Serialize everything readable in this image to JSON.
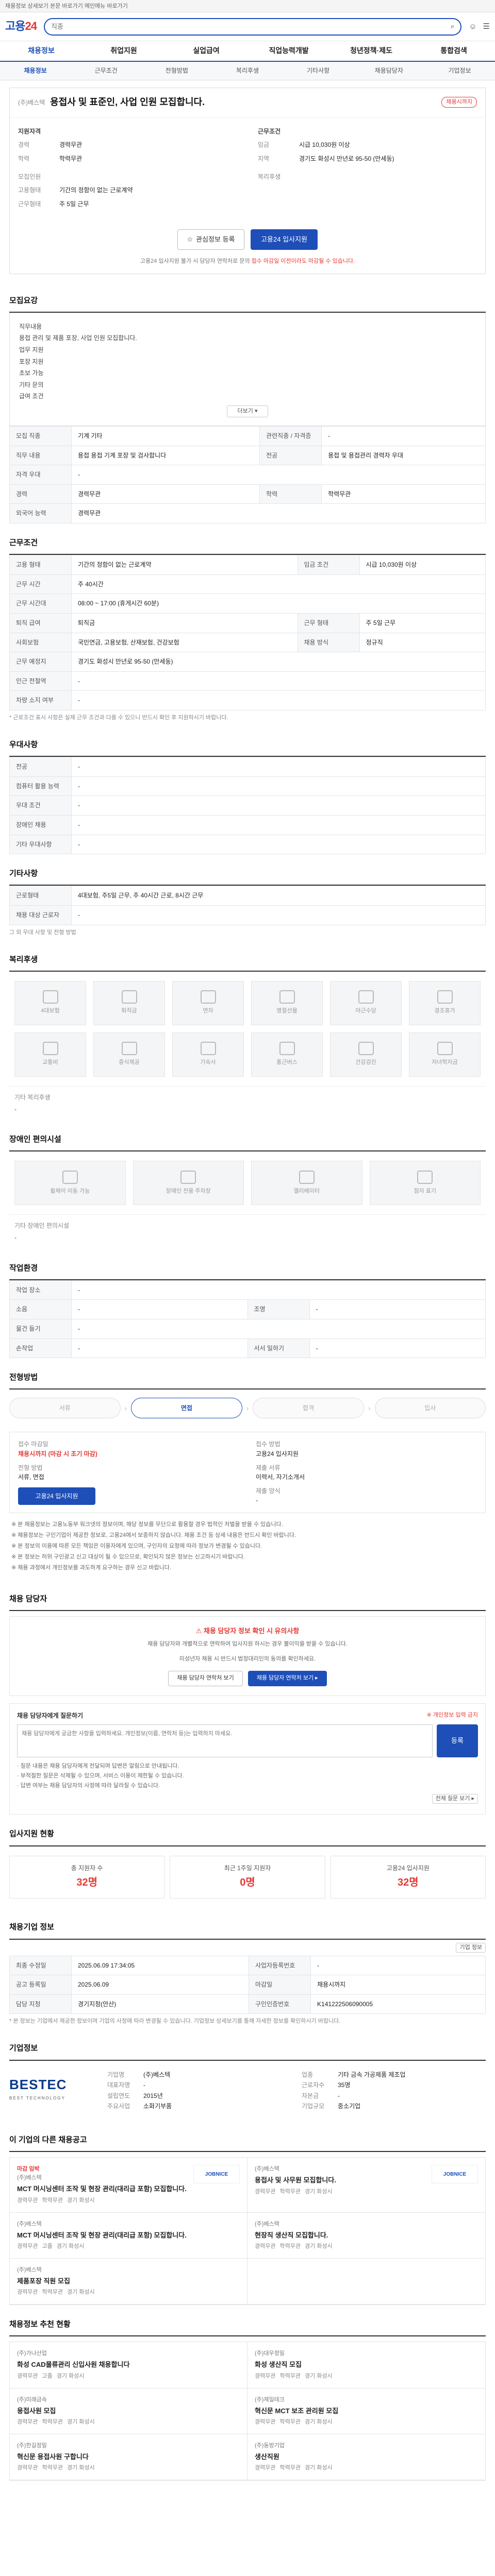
{
  "topbar": {
    "text": "채용정보 상세보기 본문 바로가기 메인메뉴 바로가기"
  },
  "header": {
    "logo_main": "고용",
    "logo_accent": "24",
    "search_placeholder": "직종"
  },
  "nav": [
    "채용정보",
    "취업지원",
    "실업급여",
    "직업능력개발",
    "청년정책·제도",
    "통합검색"
  ],
  "subnav": [
    "채용정보",
    "근무조건",
    "전형방법",
    "복리후생",
    "기타사항",
    "채용담당자",
    "기업정보"
  ],
  "job": {
    "company": "(주)베스텍",
    "title": "용접사 및 표준인, 사업 인원 모집합니다.",
    "badge": "채용시까지",
    "left_head": "지원자격",
    "right_head": "근무조건",
    "left_rows": [
      {
        "k": "경력",
        "v": "경력무관"
      },
      {
        "k": "학력",
        "v": "학력무관"
      },
      {
        "k": "",
        "v": ""
      },
      {
        "k": "모집인원",
        "v": ""
      },
      {
        "k": "고용형태",
        "v": "기간의 정함이 없는 근로계약"
      },
      {
        "k": "근무형태",
        "v": "주 5일 근무"
      }
    ],
    "right_rows": [
      {
        "k": "임금",
        "v": "시급 10,030원 이상"
      },
      {
        "k": "지역",
        "v": "경기도 화성시 만년로 95-50 (만세동)"
      },
      {
        "k": "",
        "v": ""
      },
      {
        "k": "복리후생",
        "v": ""
      }
    ],
    "btn_scrap": "관심정보 등록",
    "btn_apply": "고용24 입사지원",
    "notice_pre": "고용24 입사지원 불가 시 담당자 연락처로 문의",
    "notice_red": "접수 마감일 이전이라도 마감될 수 있습니다."
  },
  "description": {
    "title": "모집요강",
    "lines": [
      "직무내용",
      "용접 관리 및 제품 포장, 사업 인원 모집합니다.",
      "업무 지원",
      "포장 지원",
      "초보 가능",
      "기타 문의",
      "급여 조건"
    ],
    "more": "더보기 ▾"
  },
  "requirements": {
    "rows": [
      {
        "k": "모집 직종",
        "v": "기계 기타",
        "k2": "관련직종 / 자격증",
        "v2": "-"
      },
      {
        "k": "직무 내용",
        "v": "용접 용접 기계 포장 및 검사합니다",
        "k2": "전공",
        "v2": "용접 및 용접관리 경력자 우대"
      },
      {
        "k": "자격 우대",
        "v": "-",
        "k2": "",
        "v2": ""
      },
      {
        "k": "경력",
        "v": "경력무관",
        "k2": "학력",
        "v2": "학력무관"
      },
      {
        "k": "외국어 능력",
        "v": "경력무관",
        "k2": "",
        "v2": ""
      }
    ]
  },
  "conditions": {
    "title": "근무조건",
    "rows": [
      {
        "k": "고용 형태",
        "v": "기간의 정함이 없는 근로계약",
        "k2": "임금 조건",
        "v2": "시급 10,030원 이상"
      },
      {
        "k": "근무 시간",
        "v": "주 40시간",
        "k2": "",
        "v2": ""
      },
      {
        "k": "근무 시간대",
        "v": "08:00 ~ 17:00 (휴게시간 60분)",
        "k2": "",
        "v2": ""
      },
      {
        "k": "퇴직 급여",
        "v": "퇴직금",
        "k2": "근무 형태",
        "v2": "주 5일 근무"
      },
      {
        "k": "사회보험",
        "v": "국민연금, 고용보험, 산재보험, 건강보험",
        "k2": "채용 방식",
        "v2": "정규직"
      },
      {
        "k": "근무 예정지",
        "v": "경기도 화성시 만년로 95-50 (만세동)",
        "k2": "",
        "v2": ""
      },
      {
        "k": "인근 전철역",
        "v": "-",
        "k2": "",
        "v2": ""
      },
      {
        "k": "차량 소지 여부",
        "v": "-",
        "k2": "",
        "v2": ""
      }
    ],
    "note": "* 근로조건 표시 사항은 실제 근무 조건과 다를 수 있으니 반드시 확인 후 지원하시기 바랍니다."
  },
  "prefs": {
    "title": "우대사항",
    "rows": [
      {
        "k": "전공",
        "v": "-"
      },
      {
        "k": "컴퓨터 활용 능력",
        "v": "-"
      },
      {
        "k": "우대 조건",
        "v": "-"
      },
      {
        "k": "장애인 채용",
        "v": "-"
      },
      {
        "k": "기타 우대사항",
        "v": "-"
      }
    ]
  },
  "etc": {
    "title": "기타사항",
    "rows": [
      {
        "k": "근로형태",
        "v": "4대보험, 주5일 근무, 주 40시간 근로, 8시간 근무"
      },
      {
        "k": "채용 대상 근로자",
        "v": "-"
      }
    ],
    "extra": "그 외 우대 사항 및 전형 방법"
  },
  "welfare": {
    "title": "복리후생",
    "items": [
      "4대보험",
      "퇴직금",
      "연차",
      "명절선물",
      "야근수당",
      "경조휴가",
      "교통비",
      "중식제공",
      "기숙사",
      "통근버스",
      "건강검진",
      "자녀학자금"
    ],
    "extra_k": "기타 복리후생",
    "extra_v": "-"
  },
  "disability": {
    "title": "장애인 편의시설",
    "items": [
      "휠체어 이동 가능",
      "장애인 전용 주차장",
      "엘리베이터",
      "점자 표기"
    ],
    "extra_k": "기타 장애인 편의시설",
    "extra_v": "-"
  },
  "workenv": {
    "title": "작업환경",
    "rows": [
      {
        "k": "작업 장소",
        "v": "-",
        "k2": "",
        "v2": ""
      },
      {
        "k": "소음",
        "v": "-",
        "k2": "조명",
        "v2": "-"
      },
      {
        "k": "물건 들기",
        "v": "-",
        "k2": "",
        "v2": ""
      },
      {
        "k": "손작업",
        "v": "-",
        "k2": "서서 일하기",
        "v2": "-"
      }
    ]
  },
  "process": {
    "title": "전형방법",
    "steps": [
      "서류",
      "면접",
      "합격",
      "입사"
    ],
    "left": [
      {
        "k": "접수 마감일",
        "v": "채용시까지 (마감 시 조기 마감)",
        "red": true
      },
      {
        "k": "전형 방법",
        "v": "서류, 면접",
        "red": false
      }
    ],
    "left_btn": "고용24 입사지원",
    "right": [
      {
        "k": "접수 방법",
        "v": "고용24 입사지원"
      },
      {
        "k": "제출 서류",
        "v": "이력서, 자기소개서"
      },
      {
        "k": "제출 양식",
        "v": "-"
      }
    ],
    "bullets": [
      "※ 본 채용정보는 고용노동부 워크넷의 정보이며, 해당 정보를 무단으로 활용할 경우 법적인 처벌을 받을 수 있습니다.",
      "※ 채용정보는 구인기업이 제공한 정보로, 고용24에서 보증하지 않습니다. 채용 조건 등 상세 내용은 반드시 확인 바랍니다.",
      "※ 본 정보의 이용에 따른 모든 책임은 이용자에게 있으며, 구인자의 요청에 따라 정보가 변경될 수 있습니다.",
      "※ 본 정보는 허위 구인광고 신고 대상이 될 수 있으므로, 확인되지 않은 정보는 신고하시기 바랍니다.",
      "※ 채용 과정에서 개인정보를 과도하게 요구하는 경우 신고 바랍니다."
    ]
  },
  "contact": {
    "title": "채용 담당자",
    "warn": "채용 담당자 정보 확인 시 유의사항",
    "sub1": "채용 담당자와 개별적으로 연락하여 입사지원 하시는 경우 불이익을 받을 수 있습니다.",
    "sub2": "미성년자 채용 시 반드시 법정대리인의 동의를 확인하세요.",
    "btn1": "채용 담당자 연락처 보기",
    "btn2": "채용 담당자 연락처 보기 ▸",
    "qa_title": "채용 담당자에게 질문하기",
    "qa_note": "※ 개인정보 입력 금지",
    "qa_placeholder": "채용 담당자에게 궁금한 사항을 입력하세요. 개인정보(이름, 연락처 등)는 입력하지 마세요.",
    "qa_btn": "등록",
    "qa_lines": [
      "· 질문 내용은 채용 담당자에게 전달되며 답변은 알림으로 안내됩니다.",
      "· 부적절한 질문은 삭제될 수 있으며, 서비스 이용이 제한될 수 있습니다.",
      "· 답변 여부는 채용 담당자의 사정에 따라 달라질 수 있습니다."
    ],
    "qa_more": "전체 질문 보기 ▸"
  },
  "stats": {
    "title": "입사지원 현황",
    "items": [
      {
        "label": "총 지원자 수",
        "n": "32명"
      },
      {
        "label": "최근 1주일 지원자",
        "n": "0명"
      },
      {
        "label": "고용24 입사지원",
        "n": "32명"
      }
    ]
  },
  "reg": {
    "title": "채용기업 정보",
    "tag": "기업 정보",
    "rows": [
      {
        "k": "최종 수정일",
        "v": "2025.06.09 17:34:05",
        "k2": "사업자등록번호",
        "v2": "-"
      },
      {
        "k": "공고 등록일",
        "v": "2025.06.09",
        "k2": "마감일",
        "v2": "채용시까지"
      },
      {
        "k": "담당 지청",
        "v": "경기지청(안산)",
        "k2": "구인인증번호",
        "v2": "K141222506090005"
      }
    ],
    "note": "* 본 정보는 기업에서 제공한 정보이며 기업의 사정에 따라 변경될 수 있습니다. 기업정보 상세보기를 통해 자세한 정보를 확인하시기 바랍니다."
  },
  "company": {
    "title": "기업정보",
    "logo1": "BESTEC",
    "logo2": "BEST TECHNOLOGY",
    "rows": [
      {
        "k": "기업명",
        "v": "(주)베스텍"
      },
      {
        "k": "업종",
        "v": "기타 금속 가공제품 제조업"
      },
      {
        "k": "대표자명",
        "v": "-"
      },
      {
        "k": "근로자수",
        "v": "35명"
      },
      {
        "k": "설립연도",
        "v": "2015년"
      },
      {
        "k": "자본금",
        "v": "-"
      },
      {
        "k": "주요사업",
        "v": "소화기부품"
      },
      {
        "k": "기업규모",
        "v": "중소기업"
      }
    ]
  },
  "similar": {
    "title": "이 기업의 다른 채용공고",
    "items": [
      {
        "co": "(주)베스텍",
        "title": "MCT 머시닝센터 조작 및 현장 관리(대리급 포함) 모집합니다.",
        "meta": [
          "경력무관",
          "학력무관",
          "경기 화성시"
        ],
        "logo": "JOBNICE",
        "badge": "마감 임박"
      },
      {
        "co": "(주)베스텍",
        "title": "용접사 및 사무원 모집합니다.",
        "meta": [
          "경력무관",
          "학력무관",
          "경기 화성시"
        ],
        "logo": "JOBNICE",
        "badge": ""
      },
      {
        "co": "(주)베스텍",
        "title": "MCT 머시닝센터 조작 및 현장 관리(대리급 포함) 모집합니다.",
        "meta": [
          "경력무관",
          "고졸",
          "경기 화성시"
        ],
        "logo": "",
        "badge": ""
      },
      {
        "co": "(주)베스텍",
        "title": "현장직 생산직 모집합니다.",
        "meta": [
          "경력무관",
          "학력무관",
          "경기 화성시"
        ],
        "logo": "",
        "badge": ""
      },
      {
        "co": "(주)베스텍",
        "title": "제품포장 직원 모집",
        "meta": [
          "경력무관",
          "학력무관",
          "경기 화성시"
        ],
        "logo": "",
        "badge": ""
      },
      {
        "co": "",
        "title": "",
        "meta": [],
        "logo": "",
        "badge": ""
      }
    ]
  },
  "near": {
    "title": "채용정보 추천 현황",
    "items": [
      {
        "co": "(주)가나산업",
        "title": "화성 CAD물류관리 신입사원 채용합니다",
        "meta": [
          "경력무관",
          "고졸",
          "경기 화성시"
        ]
      },
      {
        "co": "(주)대우정밀",
        "title": "화성 생산직 모집",
        "meta": [
          "경력무관",
          "학력무관",
          "경기 화성시"
        ]
      },
      {
        "co": "(주)미래금속",
        "title": "용접사원 모집",
        "meta": [
          "경력무관",
          "학력무관",
          "경기 화성시"
        ]
      },
      {
        "co": "(주)제일테크",
        "title": "혁신문 MCT 보조 관리원 모집",
        "meta": [
          "경력무관",
          "학력무관",
          "경기 화성시"
        ]
      },
      {
        "co": "(주)한길정밀",
        "title": "혁신문 용접사원 구합니다",
        "meta": [
          "경력무관",
          "학력무관",
          "경기 화성시"
        ]
      },
      {
        "co": "(주)동방기업",
        "title": "생산직원",
        "meta": [
          "경력무관",
          "학력무관",
          "경기 화성시"
        ]
      }
    ]
  }
}
